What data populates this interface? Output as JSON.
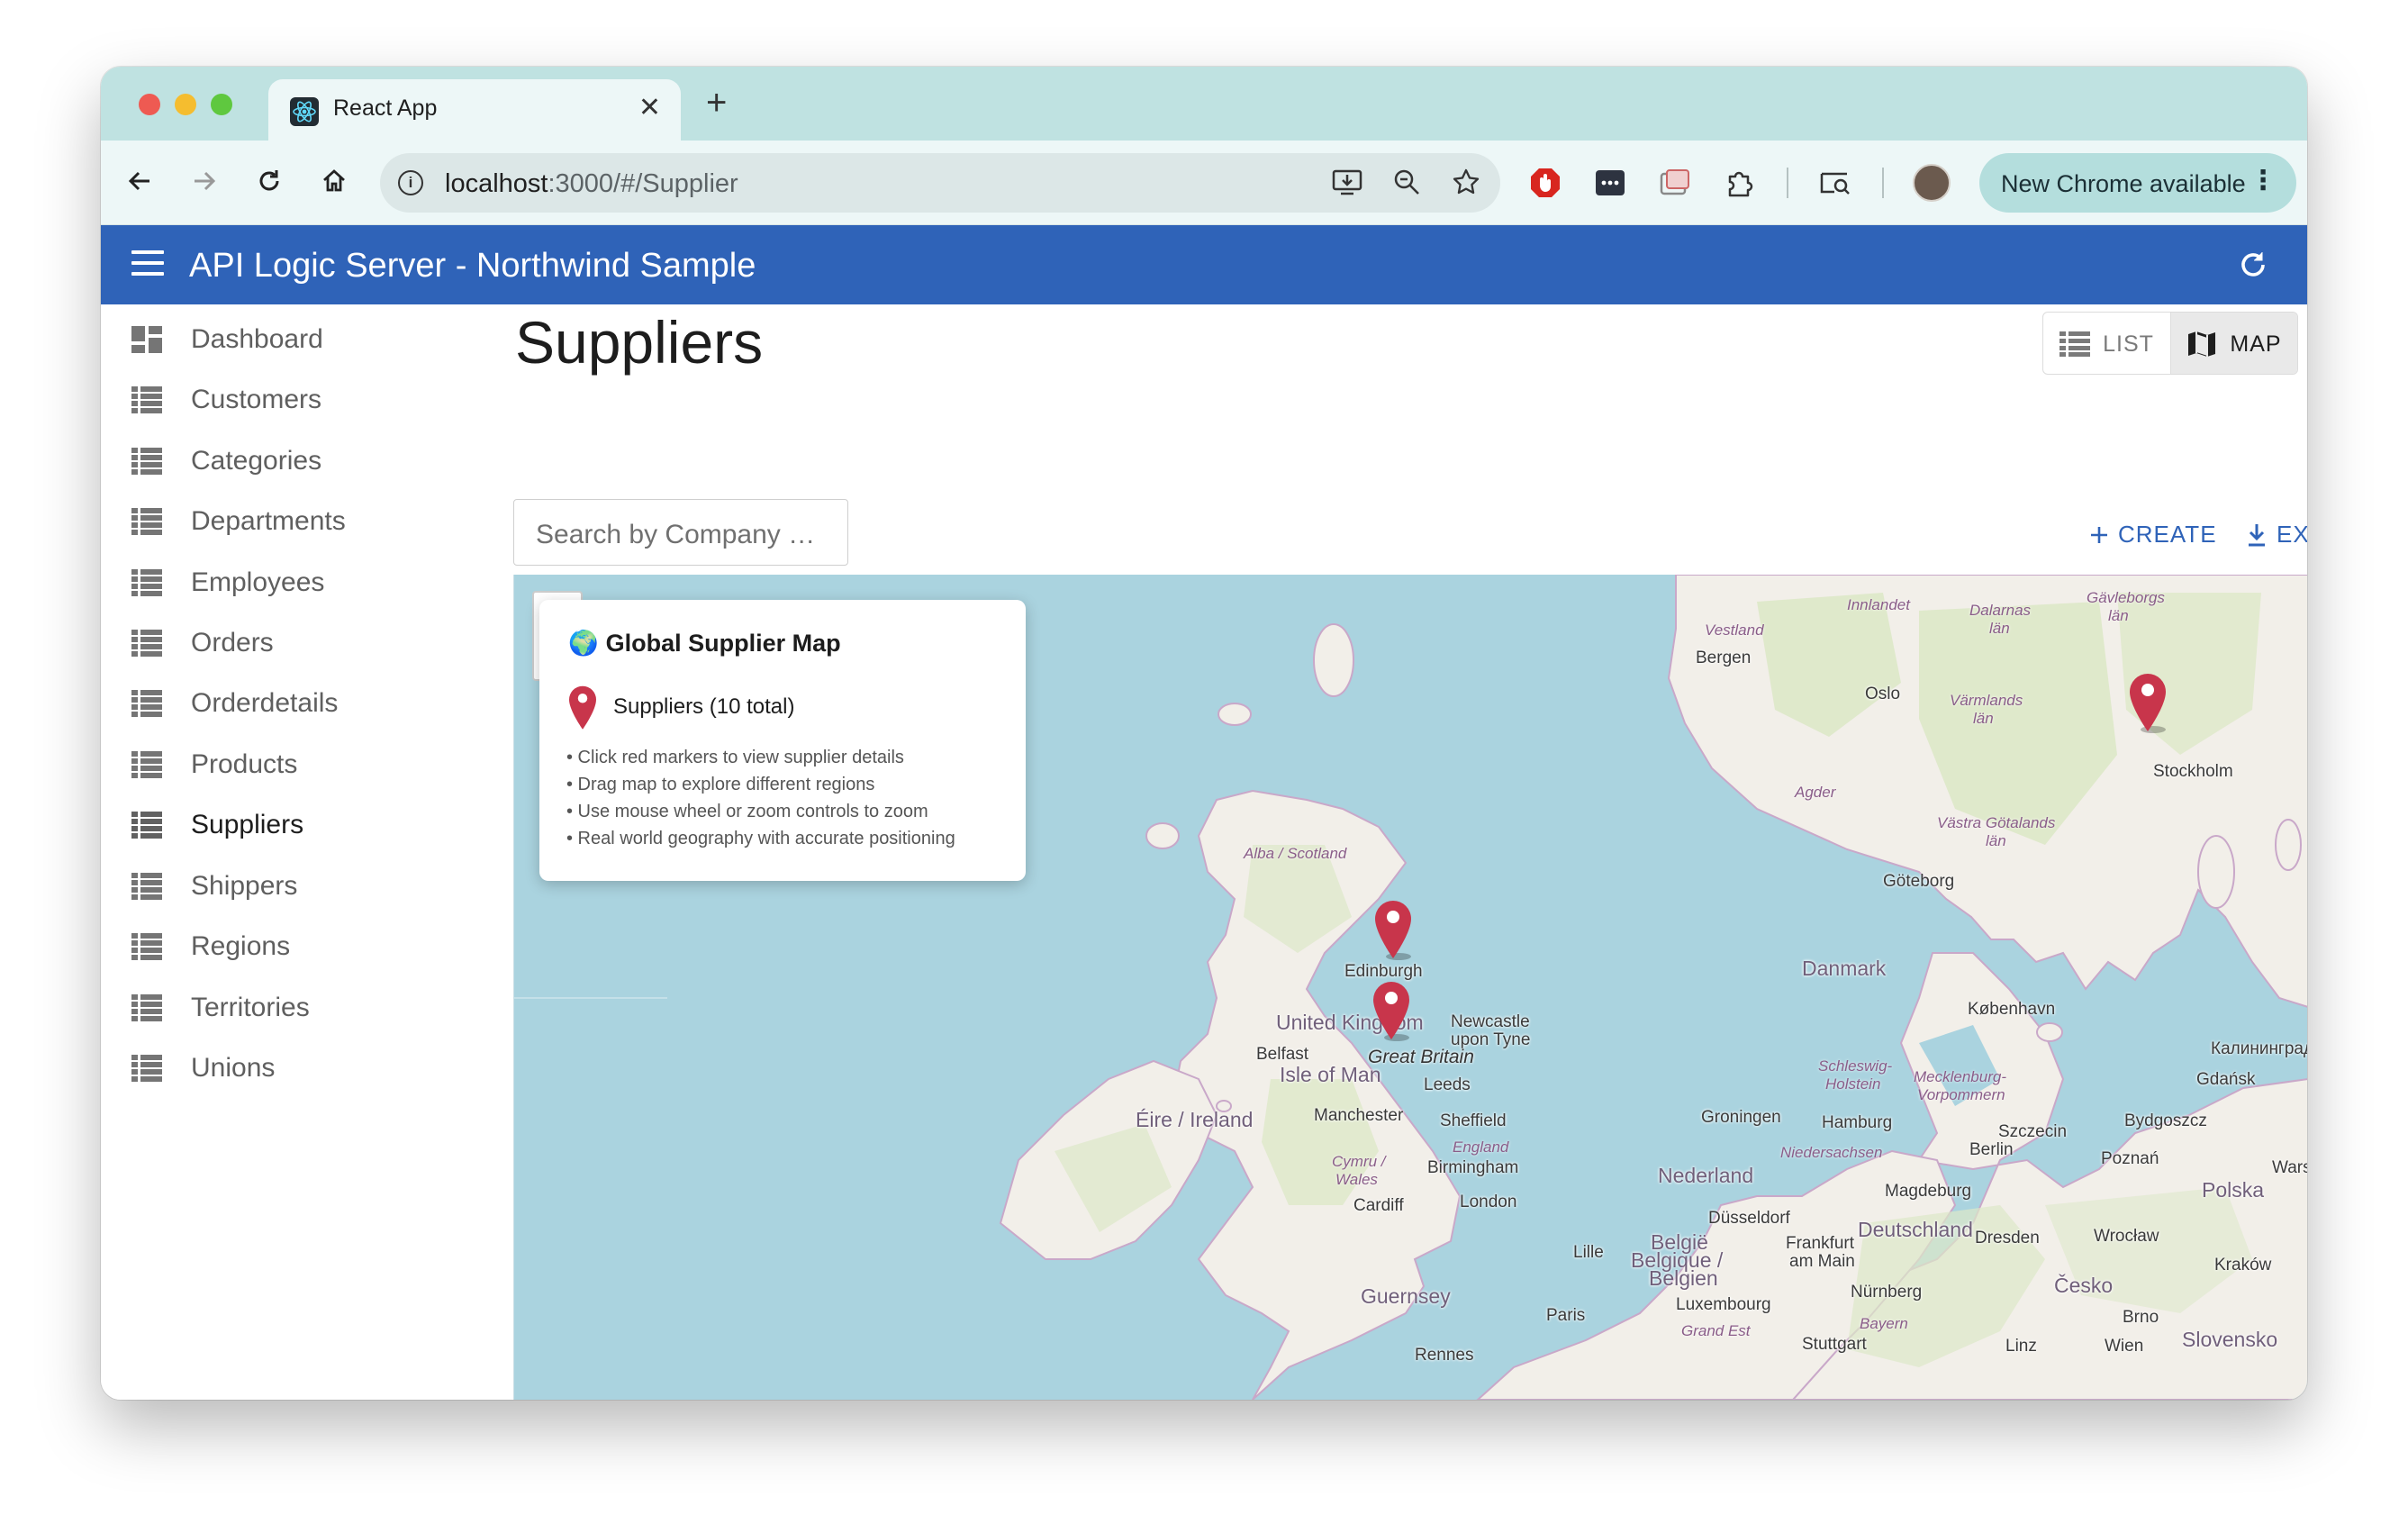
{
  "browser": {
    "tab_title": "React App",
    "url_host": "localhost",
    "url_rest": ":3000/#/Supplier",
    "update_label": "New Chrome available"
  },
  "app": {
    "title": "API Logic Server - Northwind Sample"
  },
  "sidebar": {
    "items": [
      {
        "label": "Dashboard",
        "icon": "dashboard-icon"
      },
      {
        "label": "Customers",
        "icon": "list-icon"
      },
      {
        "label": "Categories",
        "icon": "list-icon"
      },
      {
        "label": "Departments",
        "icon": "list-icon"
      },
      {
        "label": "Employees",
        "icon": "list-icon"
      },
      {
        "label": "Orders",
        "icon": "list-icon"
      },
      {
        "label": "Orderdetails",
        "icon": "list-icon"
      },
      {
        "label": "Products",
        "icon": "list-icon"
      },
      {
        "label": "Suppliers",
        "icon": "list-icon",
        "active": true
      },
      {
        "label": "Shippers",
        "icon": "list-icon"
      },
      {
        "label": "Regions",
        "icon": "list-icon"
      },
      {
        "label": "Territories",
        "icon": "list-icon"
      },
      {
        "label": "Unions",
        "icon": "list-icon"
      }
    ]
  },
  "main": {
    "title": "Suppliers",
    "view_list_label": "LIST",
    "view_map_label": "MAP",
    "search_placeholder": "Search by Company …",
    "create_label": "CREATE",
    "export_label": "EXPORT"
  },
  "map": {
    "popup_title": "Global Supplier Map",
    "popup_title_icon": "🌍",
    "legend_label": "Suppliers (10 total)",
    "hints": [
      "• Click red markers to view supplier details",
      "• Drag map to explore different regions",
      "• Use mouse wheel or zoom controls to zoom",
      "• Real world geography with accurate positioning"
    ],
    "labels": {
      "vestland": "Vestland",
      "bergen": "Bergen",
      "innlandet": "Innlandet",
      "dalarnas": "Dalarnas",
      "dalarnas2": "län",
      "gavleborgs": "Gävleborgs",
      "gavleborgs2": "län",
      "oslo": "Oslo",
      "varmlands": "Värmlands",
      "varmlands2": "län",
      "stockholm": "Stockholm",
      "agder": "Agder",
      "vastra": "Västra Götalands",
      "vastra2": "län",
      "goteborg": "Göteborg",
      "alba": "Alba / Scotland",
      "edinburgh": "Edinburgh",
      "danmark": "Danmark",
      "kobenhavn": "København",
      "uk": "United Kingdom",
      "newcastle": "Newcastle",
      "newcastle2": "upon Tyne",
      "belfast": "Belfast",
      "gb": "Great Britain",
      "isleofman": "Isle of Man",
      "leeds": "Leeds",
      "kaliningrad": "Калининградская",
      "gdansk": "Gdańsk",
      "schleswig": "Schleswig-",
      "schleswig2": "Holstein",
      "mecklenburg": "Mecklenburg-",
      "mecklenburg2": "Vorpommern",
      "eire": "Éire / Ireland",
      "manchester": "Manchester",
      "sheffield": "Sheffield",
      "groningen": "Groningen",
      "hamburg": "Hamburg",
      "szczecin": "Szczecin",
      "bydgoszcz": "Bydgoszcz",
      "england": "England",
      "niedersachsen": "Niedersachsen",
      "berlin": "Berlin",
      "poznan": "Poznań",
      "warszaw": "Warszaw",
      "cymru": "Cymru /",
      "cymru2": "Wales",
      "birmingham": "Birmingham",
      "nederland": "Nederland",
      "magdeburg": "Magdeburg",
      "polska": "Polska",
      "cardiff": "Cardiff",
      "london": "London",
      "dusseldorf": "Düsseldorf",
      "deutschland": "Deutschland",
      "belgie": "België",
      "belgique": "Belgique /",
      "belgien": "Belgien",
      "lille": "Lille",
      "frankfurt": "Frankfurt",
      "frankfurt2": "am Main",
      "dresden": "Dresden",
      "wroclaw": "Wrocław",
      "krakow": "Kraków",
      "guernsey": "Guernsey",
      "cesko": "Česko",
      "nurnberg": "Nürnberg",
      "paris": "Paris",
      "luxembourg": "Luxembourg",
      "grandest": "Grand Est",
      "bayern": "Bayern",
      "brno": "Brno",
      "stuttgart": "Stuttgart",
      "linz": "Linz",
      "wien": "Wien",
      "slovensko": "Slovensko",
      "rennes": "Rennes"
    }
  },
  "colors": {
    "appbar": "#2f63b8",
    "accent": "#2f63b8",
    "marker": "#c8354b",
    "sea": "#aad3df",
    "land": "#f2efe9"
  }
}
